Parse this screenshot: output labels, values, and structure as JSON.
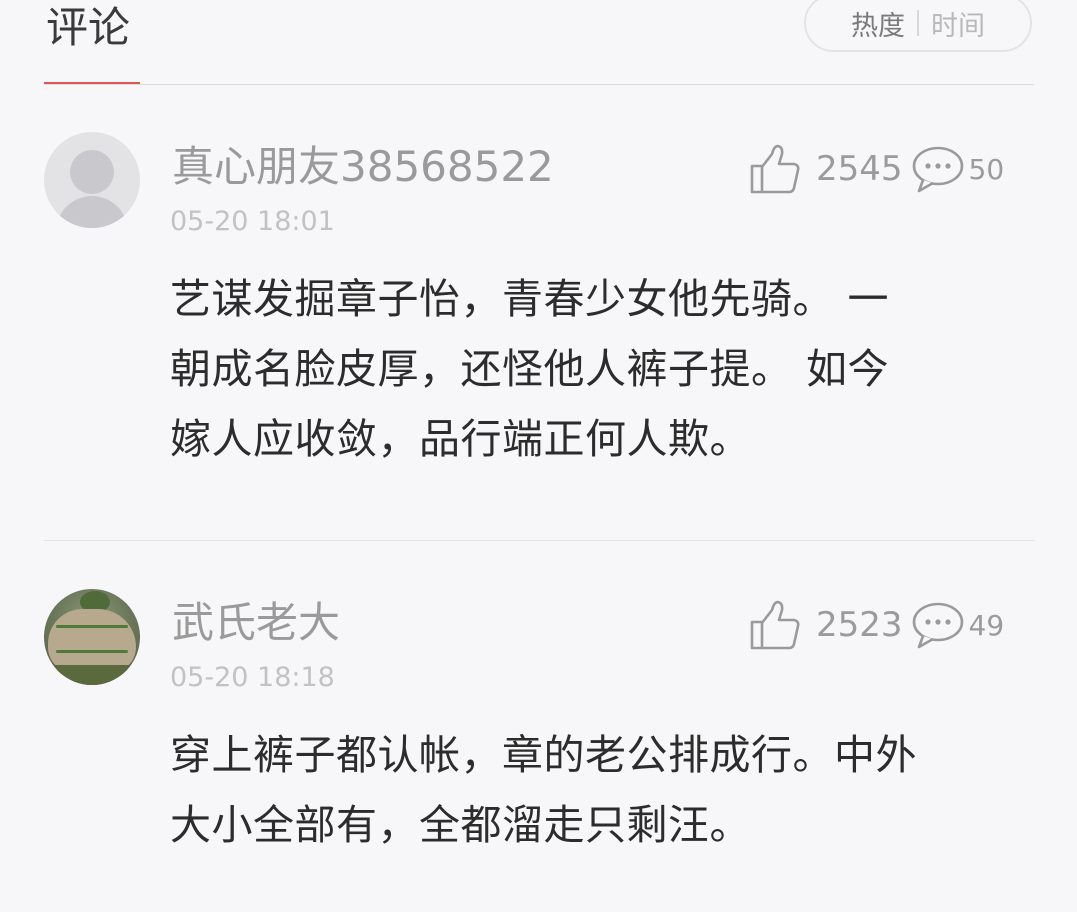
{
  "header": {
    "title": "评论",
    "sort": {
      "active": "热度",
      "inactive": "时间"
    }
  },
  "comments": [
    {
      "username": "真心朋友38568522",
      "timestamp": "05-20 18:01",
      "likes": "2545",
      "replies": "50",
      "avatar": "default-avatar",
      "lines": [
        "艺谋发掘章子怡，青春少女他先骑。 一",
        "朝成名脸皮厚，还怪他人裤子提。 如今",
        "嫁人应收敛，品行端正何人欺。"
      ]
    },
    {
      "username": "武氏老大",
      "timestamp": "05-20 18:18",
      "likes": "2523",
      "replies": "49",
      "avatar": "photo-avatar",
      "lines": [
        "穿上裤子都认帐，章的老公排成行。中外",
        "大小全部有，全都溜走只剩汪。"
      ]
    }
  ],
  "icons": {
    "like": "thumbs-up-icon",
    "reply": "speech-bubble-icon"
  },
  "colors": {
    "accent": "#e05555",
    "background": "#f7f7f9",
    "muted_text": "#9a9a9a"
  }
}
